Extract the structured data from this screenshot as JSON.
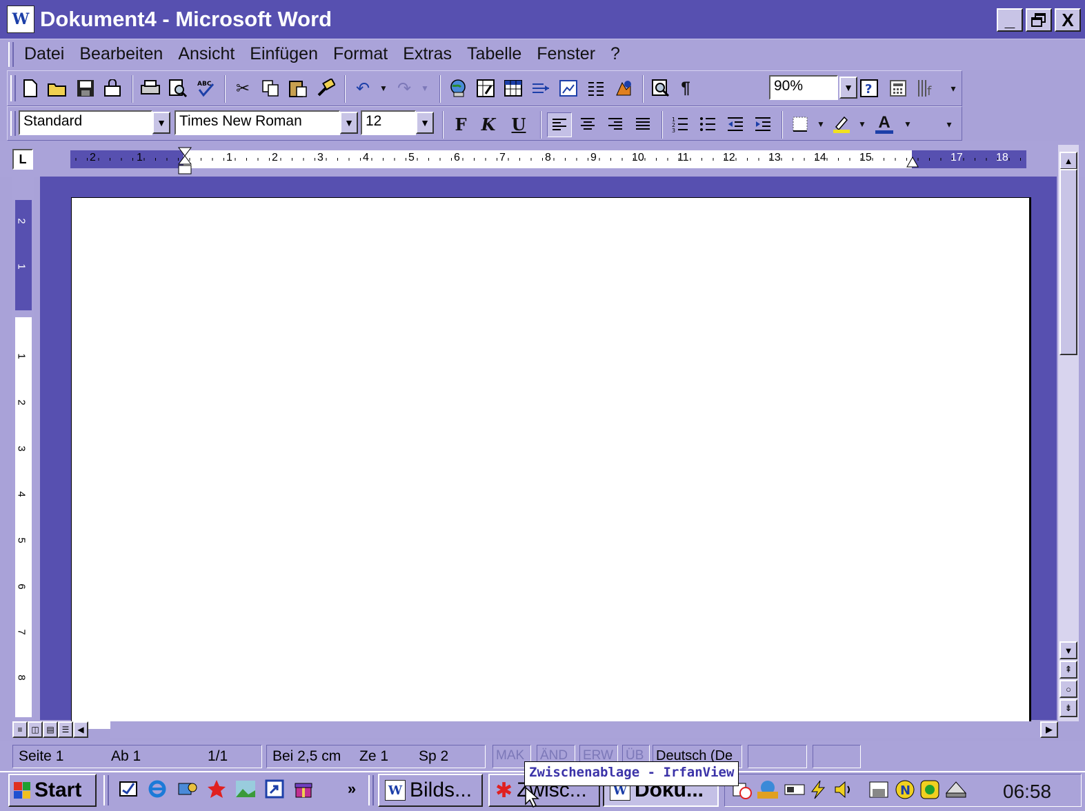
{
  "window": {
    "title": "Dokument4 - Microsoft Word",
    "app_icon": "W",
    "controls": [
      "_",
      "Ő",
      "X"
    ]
  },
  "menu": [
    "Datei",
    "Bearbeiten",
    "Ansicht",
    "Einfügen",
    "Format",
    "Extras",
    "Tabelle",
    "Fenster",
    "?"
  ],
  "standard_toolbar": {
    "zoom": "90%"
  },
  "format_toolbar": {
    "style": "Standard",
    "font": "Times New Roman",
    "size": "12",
    "bold": "F",
    "italic": "K",
    "underline": "U",
    "font_color_letter": "A"
  },
  "ruler": {
    "tab_selector": "L",
    "h_numbers": [
      "2",
      "1",
      "1",
      "2",
      "3",
      "4",
      "5",
      "6",
      "7",
      "8",
      "9",
      "10",
      "11",
      "12",
      "13",
      "14",
      "15",
      "17",
      "18"
    ],
    "v_numbers": [
      "2",
      "1",
      "1",
      "2",
      "3",
      "4",
      "5",
      "6",
      "7",
      "8"
    ]
  },
  "statusbar": {
    "page": "Seite 1",
    "section": "Ab 1",
    "pages": "1/1",
    "at": "Bei 2,5 cm",
    "line": "Ze 1",
    "col": "Sp 2",
    "mak": "MAK",
    "aend": "ÄND",
    "erw": "ERW",
    "ueb": "ÜB",
    "language": "Deutsch (De"
  },
  "taskbar": {
    "start": "Start",
    "chevron": "»",
    "tasks": [
      "Bilds...",
      "Zwisc...",
      "Doku..."
    ],
    "clock": "06:58"
  },
  "tooltip": "Zwischenablage - IrfanView",
  "colors": {
    "titlebar": "#5750b0",
    "chrome": "#aaa3d9",
    "workspace": "#5750b0"
  }
}
